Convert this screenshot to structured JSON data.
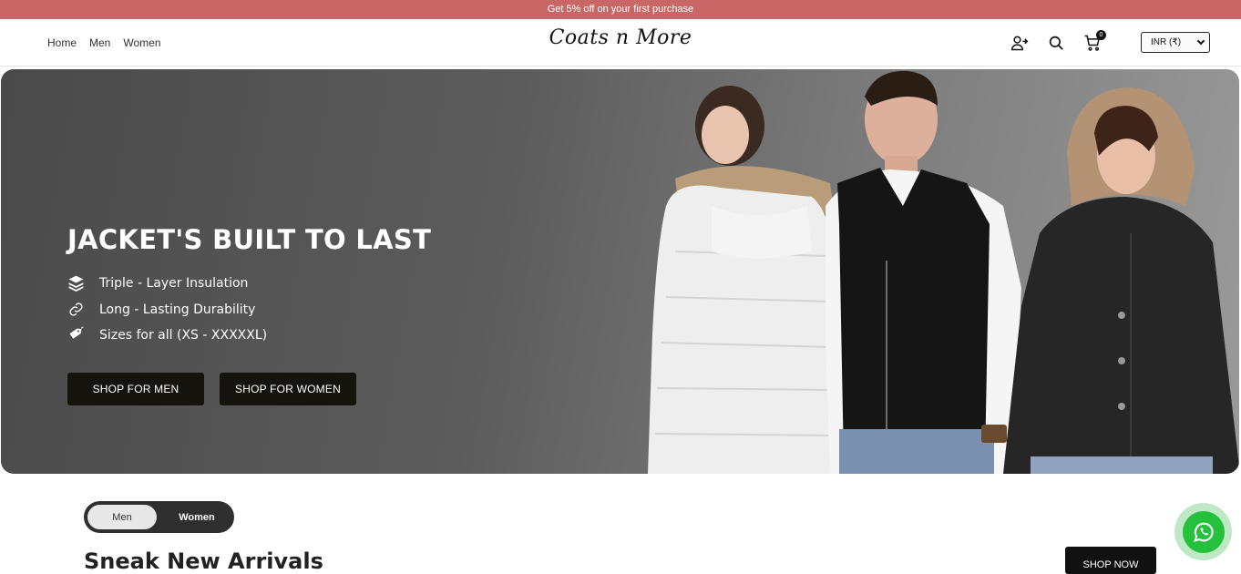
{
  "announcement": "Get 5% off on your first purchase",
  "nav": {
    "home": "Home",
    "men": "Men",
    "women": "Women"
  },
  "brand": "Coats n More",
  "cart": {
    "count": "0"
  },
  "currency": {
    "selected": "INR (₹)"
  },
  "hero": {
    "title": "JACKET'S BUILT TO LAST",
    "features": [
      {
        "icon": "layers-icon",
        "text": "Triple - Layer Insulation"
      },
      {
        "icon": "link-icon",
        "text": "Long - Lasting Durability"
      },
      {
        "icon": "tag-icon",
        "text": "Sizes for all (XS - XXXXXL)"
      }
    ],
    "cta_men": "SHOP FOR MEN",
    "cta_women": "SHOP FOR WOMEN"
  },
  "toggle": {
    "men": "Men",
    "women": "Women",
    "selected": "Men"
  },
  "section": {
    "title": "Sneak New Arrivals",
    "shop_now": "SHOP NOW"
  },
  "colors": {
    "announcement_bg": "#c86766",
    "button_dark": "#14140c",
    "whatsapp": "#25c13c"
  }
}
